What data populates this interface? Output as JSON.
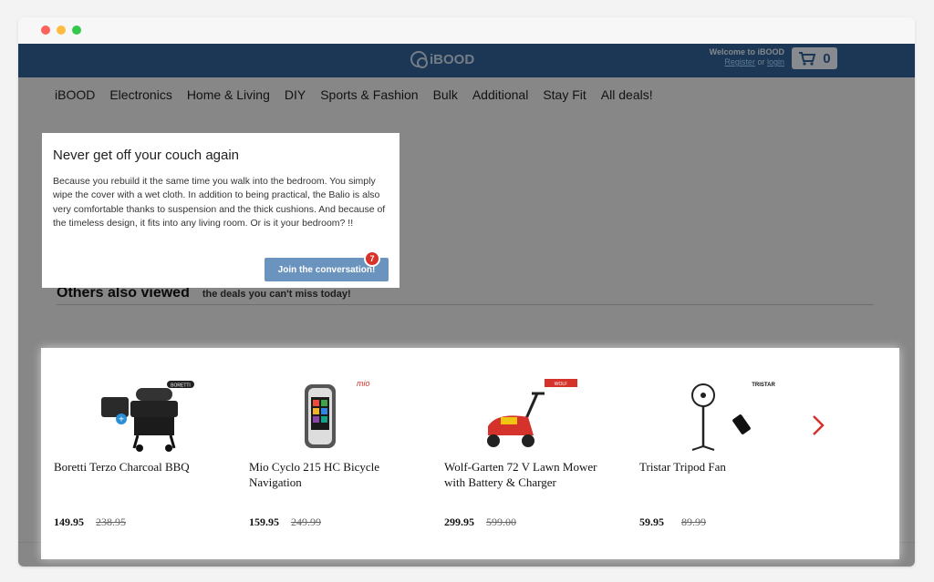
{
  "brand": {
    "name": "iBOOD"
  },
  "header": {
    "welcome": "Welcome to iBOOD",
    "register_label": "Register",
    "or_label": "or",
    "login_label": "login",
    "cart_count": "0"
  },
  "nav": {
    "items": [
      "iBOOD",
      "Electronics",
      "Home & Living",
      "DIY",
      "Sports & Fashion",
      "Bulk",
      "Additional",
      "Stay Fit",
      "All deals!"
    ]
  },
  "popup": {
    "title": "Never get off your couch again",
    "body": "Because you rebuild it the same time you walk into the bedroom. You simply wipe the cover with a wet cloth. In addition to being practical, the Balio is also very comfortable thanks to suspension and the thick cushions. And because of the timeless design, it fits into any living room. Or is it your bedroom? !!",
    "button_label": "Join the conversation!",
    "comment_count": "7"
  },
  "section": {
    "title": "Others also viewed",
    "subtitle": "the deals you can't miss today!"
  },
  "products": [
    {
      "name": "Boretti Terzo Charcoal BBQ",
      "price": "149.95",
      "old_price": "238.95",
      "brand_label": "BORETTI"
    },
    {
      "name": "Mio Cyclo 215 HC Bicycle Navigation",
      "price": "159.95",
      "old_price": "249.99",
      "brand_label": "mio"
    },
    {
      "name": "Wolf-Garten 72 V Lawn Mower with Battery & Charger",
      "price": "299.95",
      "old_price": "599.00",
      "brand_label": "WOLF"
    },
    {
      "name": "Tristar Tripod Fan",
      "price": "59.95",
      "old_price": "89.99",
      "brand_label": "TRISTAR"
    }
  ],
  "colors": {
    "topbar": "#2f5f93",
    "accent_red": "#d4322a",
    "button": "#6a93bd"
  }
}
